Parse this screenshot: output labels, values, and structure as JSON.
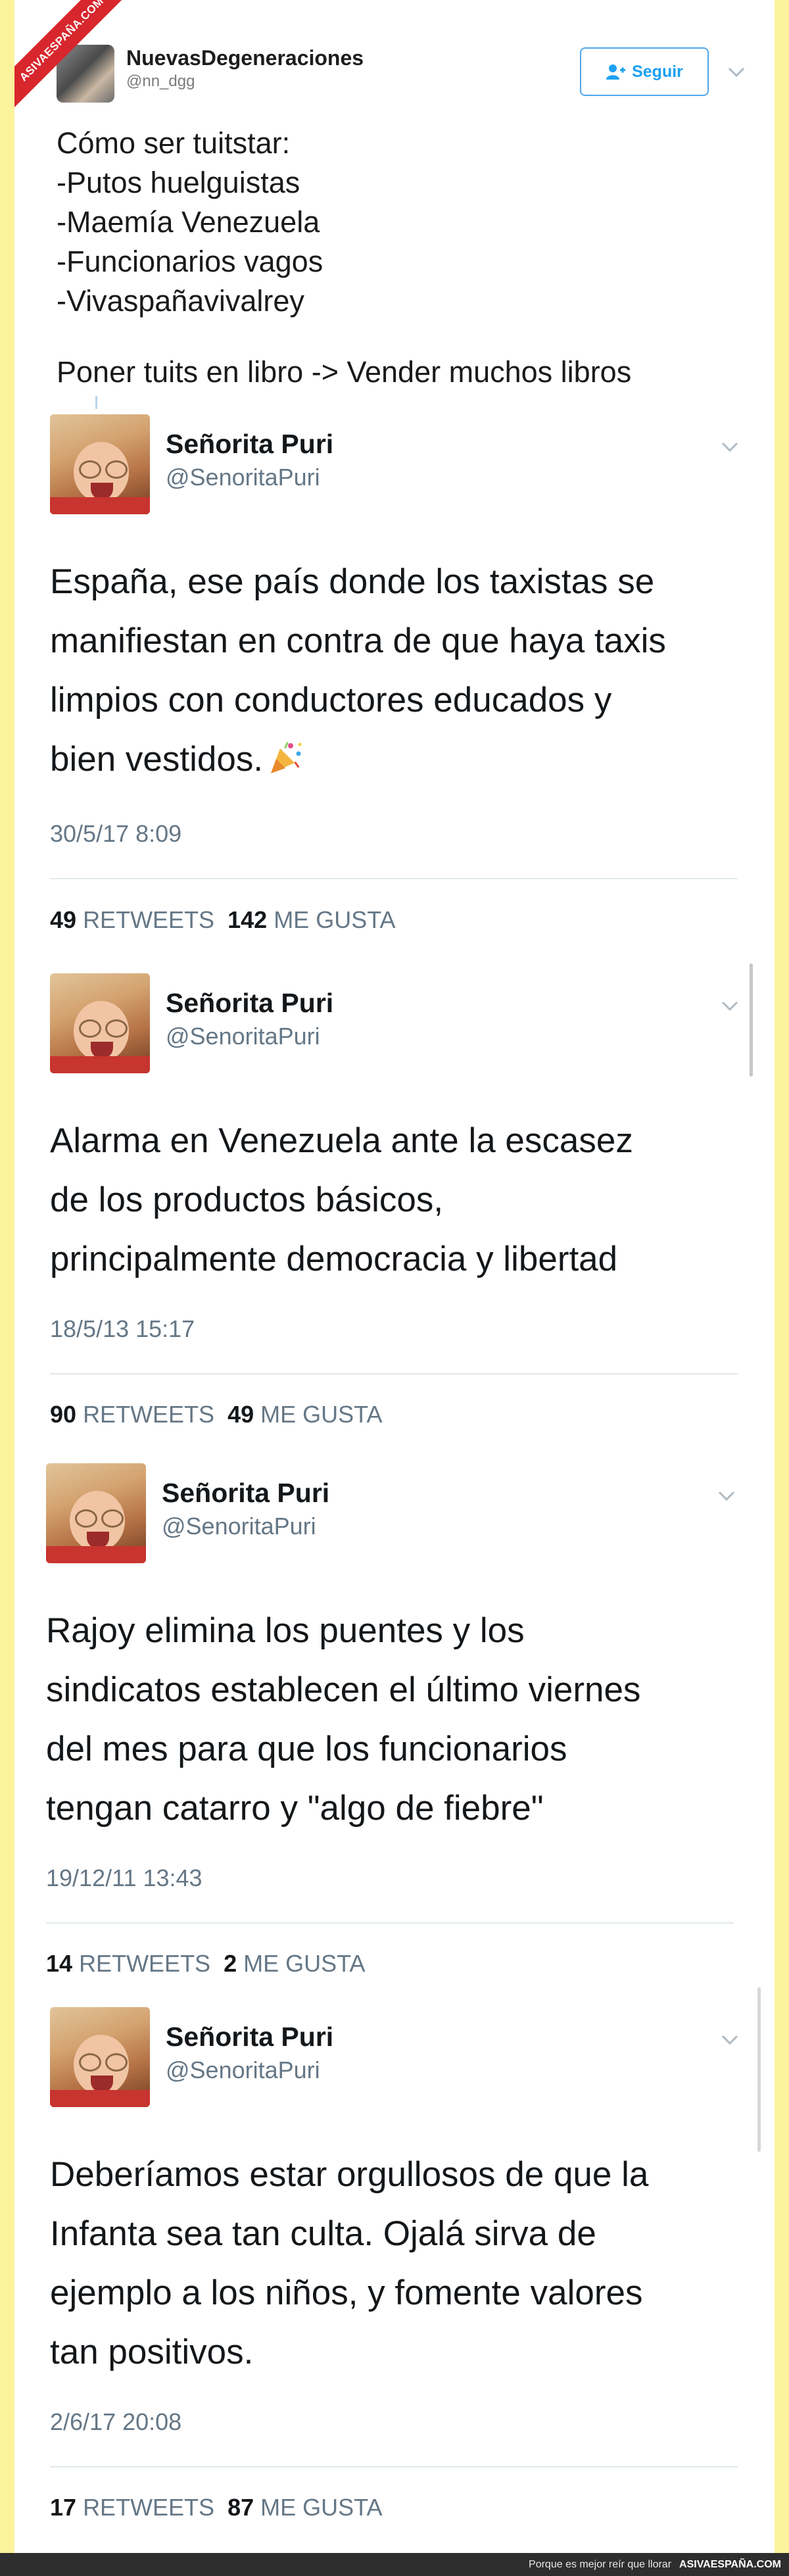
{
  "watermark": {
    "ribbon": "ASIVAESPAÑA.COM",
    "slogan": "Porque es mejor reír que llorar",
    "site": "ASIVAESPAÑA.COM"
  },
  "header": {
    "name": "NuevasDegeneraciones",
    "handle": "@nn_dgg",
    "follow_label": "Seguir",
    "follow_icon": "add-user-icon",
    "menu_icon": "chevron-down-icon",
    "intro_lines": [
      "Cómo ser tuitstar:",
      "-Putos huelguistas",
      "-Maemía Venezuela",
      "-Funcionarios vagos",
      "-Vivaspañavivalrey"
    ],
    "intro_footer": "Poner tuits en libro -> Vender muchos libros"
  },
  "tweets": [
    {
      "name": "Señorita Puri",
      "handle": "@SenoritaPuri",
      "lines": [
        "España, ese país donde los taxistas se",
        "manifiestan en contra de que haya taxis",
        "limpios con conductores educados y",
        "bien vestidos."
      ],
      "emoji": "party-popper-icon",
      "date": "30/5/17 8:09",
      "retweets": "49",
      "retweets_label": "RETWEETS",
      "likes": "142",
      "likes_label": "ME GUSTA"
    },
    {
      "name": "Señorita Puri",
      "handle": "@SenoritaPuri",
      "lines": [
        "Alarma en Venezuela ante la escasez",
        "de los productos básicos,",
        "principalmente democracia y libertad"
      ],
      "date": "18/5/13 15:17",
      "retweets": "90",
      "retweets_label": "RETWEETS",
      "likes": "49",
      "likes_label": "ME GUSTA"
    },
    {
      "name": "Señorita Puri",
      "handle": "@SenoritaPuri",
      "lines": [
        "Rajoy elimina los puentes y los",
        "sindicatos establecen el último viernes",
        "del mes para que los funcionarios",
        "tengan catarro y \"algo de fiebre\""
      ],
      "date": "19/12/11 13:43",
      "retweets": "14",
      "retweets_label": "RETWEETS",
      "likes": "2",
      "likes_label": "ME GUSTA"
    },
    {
      "name": "Señorita Puri",
      "handle": "@SenoritaPuri",
      "lines": [
        "Deberíamos estar orgullosos de que la",
        "Infanta sea tan culta. Ojalá sirva de",
        "ejemplo a los niños, y fomente valores",
        "tan positivos."
      ],
      "date": "2/6/17 20:08",
      "retweets": "17",
      "retweets_label": "RETWEETS",
      "likes": "87",
      "likes_label": "ME GUSTA"
    }
  ]
}
